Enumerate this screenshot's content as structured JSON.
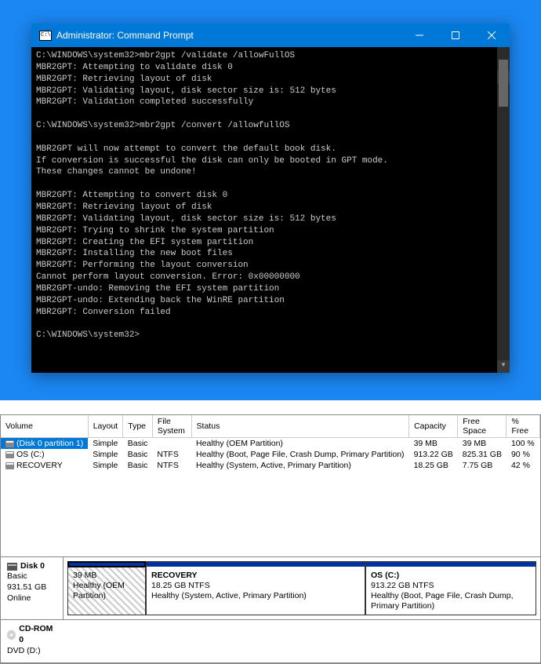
{
  "cmd": {
    "title": "Administrator: Command Prompt",
    "lines": [
      "C:\\WINDOWS\\system32>mbr2gpt /validate /allowFullOS",
      "MBR2GPT: Attempting to validate disk 0",
      "MBR2GPT: Retrieving layout of disk",
      "MBR2GPT: Validating layout, disk sector size is: 512 bytes",
      "MBR2GPT: Validation completed successfully",
      "",
      "C:\\WINDOWS\\system32>mbr2gpt /convert /allowfullOS",
      "",
      "MBR2GPT will now attempt to convert the default book disk.",
      "If conversion is successful the disk can only be booted in GPT mode.",
      "These changes cannot be undone!",
      "",
      "MBR2GPT: Attempting to convert disk 0",
      "MBR2GPT: Retrieving layout of disk",
      "MBR2GPT: Validating layout, disk sector size is: 512 bytes",
      "MBR2GPT: Trying to shrink the system partition",
      "MBR2GPT: Creating the EFI system partition",
      "MBR2GPT: Installing the new boot files",
      "MBR2GPT: Performing the layout conversion",
      "Cannot perform layout conversion. Error: 0x00000000",
      "MBR2GPT-undo: Removing the EFI system partition",
      "MBR2GPT-undo: Extending back the WinRE partition",
      "MBR2GPT: Conversion failed",
      "",
      "C:\\WINDOWS\\system32>"
    ]
  },
  "dm": {
    "headers": [
      "Volume",
      "Layout",
      "Type",
      "File System",
      "Status",
      "Capacity",
      "Free Space",
      "% Free"
    ],
    "rows": [
      {
        "volume": "(Disk 0 partition 1)",
        "layout": "Simple",
        "type": "Basic",
        "fs": "",
        "status": "Healthy (OEM Partition)",
        "capacity": "39 MB",
        "free": "39 MB",
        "pct": "100 %",
        "selected": true
      },
      {
        "volume": "OS (C:)",
        "layout": "Simple",
        "type": "Basic",
        "fs": "NTFS",
        "status": "Healthy (Boot, Page File, Crash Dump, Primary Partition)",
        "capacity": "913.22 GB",
        "free": "825.31 GB",
        "pct": "90 %",
        "selected": false
      },
      {
        "volume": "RECOVERY",
        "layout": "Simple",
        "type": "Basic",
        "fs": "NTFS",
        "status": "Healthy (System, Active, Primary Partition)",
        "capacity": "18.25 GB",
        "free": "7.75 GB",
        "pct": "42 %",
        "selected": false
      }
    ],
    "disk0": {
      "name": "Disk 0",
      "type": "Basic",
      "size": "931.51 GB",
      "state": "Online",
      "p1": {
        "size": "39 MB",
        "status": "Healthy (OEM Partition)"
      },
      "p2": {
        "name": "RECOVERY",
        "size": "18.25 GB NTFS",
        "status": "Healthy (System, Active, Primary Partition)"
      },
      "p3": {
        "name": "OS  (C:)",
        "size": "913.22 GB NTFS",
        "status": "Healthy (Boot, Page File, Crash Dump, Primary Partition)"
      }
    },
    "cdrom": {
      "name": "CD-ROM 0",
      "sub": "DVD (D:)"
    }
  }
}
